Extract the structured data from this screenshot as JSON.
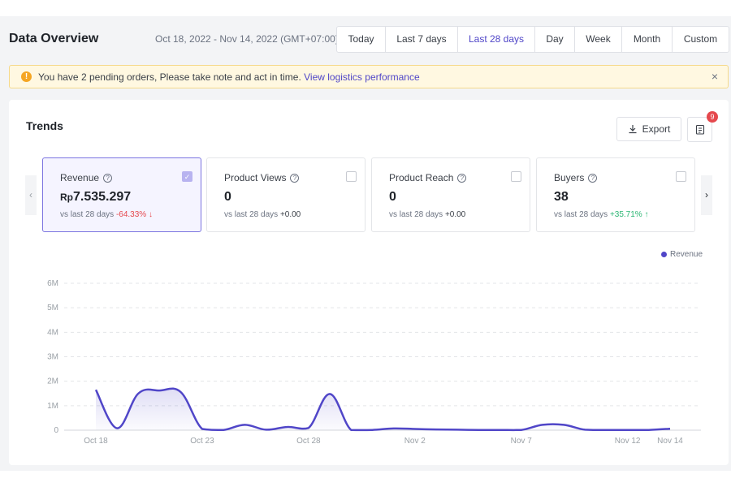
{
  "header": {
    "title": "Data Overview",
    "date_range": "Oct 18, 2022 - Nov 14, 2022 (GMT+07:00)",
    "tabs": [
      {
        "label": "Today"
      },
      {
        "label": "Last 7 days"
      },
      {
        "label": "Last 28 days",
        "active": true
      },
      {
        "label": "Day"
      },
      {
        "label": "Week"
      },
      {
        "label": "Month"
      },
      {
        "label": "Custom"
      }
    ]
  },
  "notice": {
    "icon": "warning-icon",
    "text": "You have 2 pending orders, Please take note and act in time.",
    "link": "View logistics performance",
    "close": "×"
  },
  "trends": {
    "title": "Trends",
    "export_label": "Export",
    "badge_count": "9",
    "metrics": [
      {
        "label": "Revenue",
        "currency": "Rp",
        "value": "7.535.297",
        "compare": "vs last 28 days",
        "change": "-64.33%",
        "trend": "down",
        "checked": true
      },
      {
        "label": "Product Views",
        "currency": "",
        "value": "0",
        "compare": "vs last 28 days",
        "change": "+0.00",
        "trend": "neutral",
        "checked": false
      },
      {
        "label": "Product Reach",
        "currency": "",
        "value": "0",
        "compare": "vs last 28 days",
        "change": "+0.00",
        "trend": "neutral",
        "checked": false
      },
      {
        "label": "Buyers",
        "currency": "",
        "value": "38",
        "compare": "vs last 28 days",
        "change": "+35.71%",
        "trend": "up",
        "checked": false
      }
    ]
  },
  "colors": {
    "accent": "#5046c8",
    "down": "#e5484d",
    "up": "#2bb673"
  },
  "chart_data": {
    "type": "line",
    "series": [
      {
        "name": "Revenue",
        "values": [
          1650000,
          80000,
          1500000,
          1620000,
          1550000,
          50000,
          10000,
          220000,
          20000,
          130000,
          90000,
          1480000,
          10000,
          10000,
          70000,
          50000,
          30000,
          20000,
          10000,
          10000,
          10000,
          220000,
          220000,
          20000,
          10000,
          10000,
          10000,
          60000
        ]
      }
    ],
    "x": [
      "Oct 18",
      "Oct 19",
      "Oct 20",
      "Oct 21",
      "Oct 22",
      "Oct 23",
      "Oct 24",
      "Oct 25",
      "Oct 26",
      "Oct 27",
      "Oct 28",
      "Oct 29",
      "Oct 30",
      "Oct 31",
      "Nov 1",
      "Nov 2",
      "Nov 3",
      "Nov 4",
      "Nov 5",
      "Nov 6",
      "Nov 7",
      "Nov 8",
      "Nov 9",
      "Nov 10",
      "Nov 11",
      "Nov 12",
      "Nov 13",
      "Nov 14"
    ],
    "x_ticks": [
      "Oct 18",
      "Oct 23",
      "Oct 28",
      "Nov 2",
      "Nov 7",
      "Nov 12",
      "Nov 14"
    ],
    "y_ticks": [
      "0",
      "1M",
      "2M",
      "3M",
      "4M",
      "5M",
      "6M"
    ],
    "ylim": [
      0,
      6000000
    ],
    "legend": "top-right",
    "grid": true
  }
}
